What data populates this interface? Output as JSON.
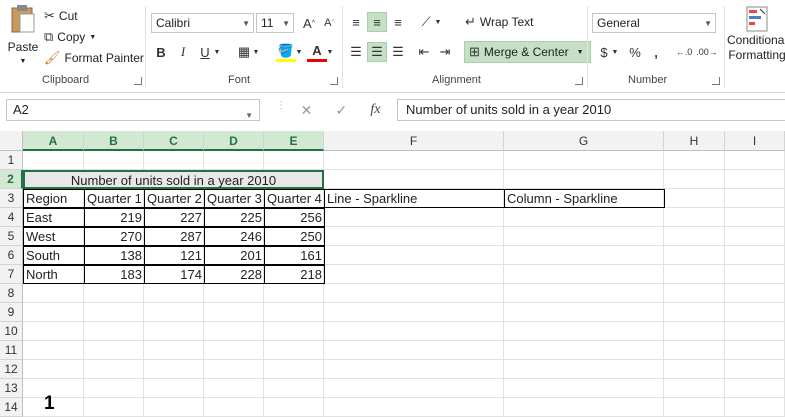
{
  "ribbon": {
    "clipboard": {
      "paste": "Paste",
      "cut": "Cut",
      "copy": "Copy",
      "format_painter": "Format Painter",
      "label": "Clipboard"
    },
    "font": {
      "name": "Calibri",
      "size": "11",
      "bold": "B",
      "italic": "I",
      "underline": "U",
      "label": "Font"
    },
    "alignment": {
      "wrap_text": "Wrap Text",
      "merge_center": "Merge & Center",
      "label": "Alignment"
    },
    "number": {
      "format": "General",
      "currency": "$",
      "percent": "%",
      "comma": ",",
      "label": "Number"
    },
    "styles": {
      "conditional_formatting_1": "Conditional",
      "conditional_formatting_2": "Formatting"
    }
  },
  "formula_bar": {
    "name_box": "A2",
    "fx": "fx",
    "content": "Number of units sold in a year 2010"
  },
  "sheet": {
    "columns": [
      "A",
      "B",
      "C",
      "D",
      "E",
      "F",
      "G",
      "H",
      "I"
    ],
    "rows": [
      "1",
      "2",
      "3",
      "4",
      "5",
      "6",
      "7",
      "8",
      "9",
      "10",
      "11",
      "12",
      "13",
      "14"
    ],
    "title": "Number of units sold in a year 2010",
    "headers": [
      "Region",
      "Quarter 1",
      "Quarter 2",
      "Quarter 3",
      "Quarter 4"
    ],
    "f3": "Line - Sparkline",
    "g3": "Column - Sparkline",
    "data": [
      {
        "region": "East",
        "q1": "219",
        "q2": "227",
        "q3": "225",
        "q4": "256"
      },
      {
        "region": "West",
        "q1": "270",
        "q2": "287",
        "q3": "246",
        "q4": "250"
      },
      {
        "region": "South",
        "q1": "138",
        "q2": "121",
        "q3": "201",
        "q4": "161"
      },
      {
        "region": "North",
        "q1": "183",
        "q2": "174",
        "q3": "228",
        "q4": "218"
      }
    ]
  },
  "annotation": "1",
  "colors": {
    "accent": "#217346",
    "highlight": "#c5e0c5"
  }
}
